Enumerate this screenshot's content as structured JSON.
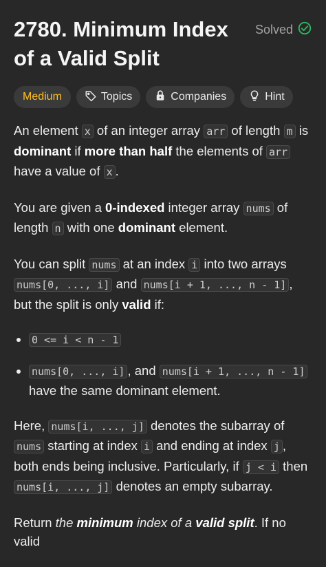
{
  "problem": {
    "title": "2780. Minimum Index of a Valid Split",
    "status": "Solved"
  },
  "chips": {
    "difficulty": "Medium",
    "topics": "Topics",
    "companies": "Companies",
    "hint": "Hint"
  },
  "colors": {
    "background": "#282828",
    "difficulty_medium": "#ffc01e",
    "solved_check": "#2cbb5d"
  },
  "icons": {
    "solved": "check-circle-icon",
    "topics": "tag-icon",
    "companies": "lock-icon",
    "hint": "lightbulb-icon"
  },
  "description": {
    "p1": {
      "t1": "An element ",
      "c1": "x",
      "t2": " of an integer array ",
      "c2": "arr",
      "t3": " of length ",
      "c3": "m",
      "t4": " is ",
      "b1": "dominant",
      "t5": " if ",
      "b2": "more than half",
      "t6": " the elements of ",
      "c4": "arr",
      "t7": " have a value of ",
      "c5": "x",
      "t8": "."
    },
    "p2": {
      "t1": "You are given a ",
      "b1": "0-indexed",
      "t2": " integer array ",
      "c1": "nums",
      "t3": " of length ",
      "c2": "n",
      "t4": " with one ",
      "b2": "dominant",
      "t5": " element."
    },
    "p3": {
      "t1": "You can split ",
      "c1": "nums",
      "t2": " at an index ",
      "c2": "i",
      "t3": " into two arrays ",
      "c3": "nums[0, ..., i]",
      "t4": " and ",
      "c4": "nums[i + 1, ..., n - 1]",
      "t5": ", but the split is only ",
      "b1": "valid",
      "t6": " if:"
    },
    "bullets": {
      "b1": {
        "c1": "0 <= i < n - 1"
      },
      "b2": {
        "c1": "nums[0, ..., i]",
        "t1": ", and ",
        "c2": "nums[i + 1, ..., n - 1]",
        "t2": " have the same dominant element."
      }
    },
    "p4": {
      "t1": "Here, ",
      "c1": "nums[i, ..., j]",
      "t2": " denotes the subarray of ",
      "c2": "nums",
      "t3": " starting at index ",
      "c3": "i",
      "t4": " and ending at index ",
      "c4": "j",
      "t5": ", both ends being inclusive. Particularly, if ",
      "c5": "j < i",
      "t6": " then ",
      "c6": "nums[i, ..., j]",
      "t7": " denotes an empty subarray."
    },
    "p5": {
      "t1": "Return ",
      "i1": "the ",
      "bi1": "minimum",
      "i2": " index of a ",
      "bi2": "valid split",
      "t2": ". If no valid"
    }
  }
}
